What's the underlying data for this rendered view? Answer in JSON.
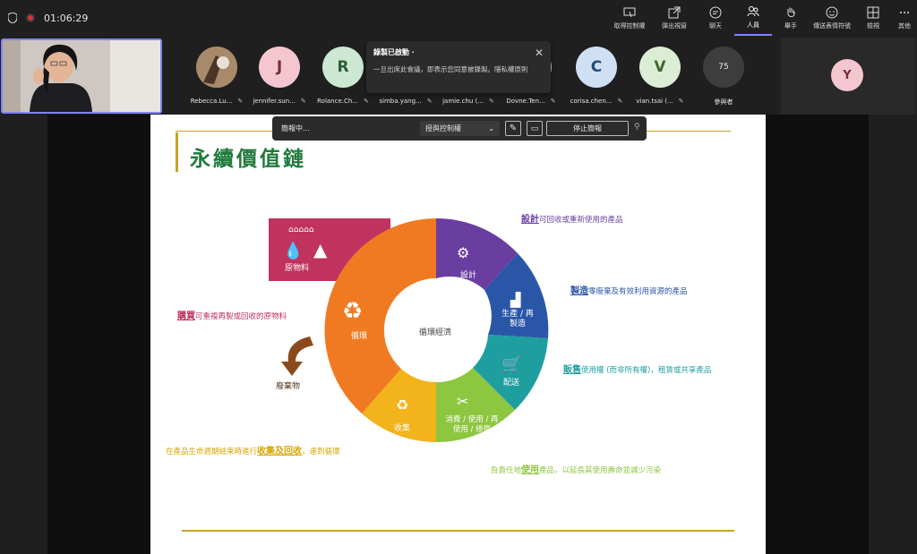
{
  "meeting": {
    "elapsed": "01:06:29"
  },
  "toolbar": {
    "items": [
      {
        "label": "取得控制權",
        "icon": "take-control-icon"
      },
      {
        "label": "彈出視窗",
        "icon": "pop-out-icon"
      },
      {
        "label": "聊天",
        "icon": "chat-icon"
      },
      {
        "label": "人員",
        "icon": "people-icon"
      },
      {
        "label": "舉手",
        "icon": "raise-hand-icon"
      },
      {
        "label": "傳送表情符號",
        "icon": "emoji-icon"
      },
      {
        "label": "檢視",
        "icon": "view-icon"
      },
      {
        "label": "其他",
        "icon": "more-icon"
      }
    ]
  },
  "participants": [
    {
      "name": "Rebecca.Lu...",
      "initial": "",
      "color": "#8a6b4d"
    },
    {
      "name": "jennifer.sun...",
      "initial": "J",
      "color": "#f4c7d0"
    },
    {
      "name": "Rolance.Ch...",
      "initial": "R",
      "color": "#cde8d2"
    },
    {
      "name": "simba.yang...",
      "initial": "",
      "color": "#d8d8d8"
    },
    {
      "name": "jamie.chu (...",
      "initial": "",
      "color": "#d8d8d8"
    },
    {
      "name": "Dovne.Ten...",
      "initial": "",
      "color": "#f4c7d0"
    },
    {
      "name": "corisa.chen...",
      "initial": "C",
      "color": "#cfe0f5"
    },
    {
      "name": "vian.tsai (...",
      "initial": "V",
      "color": "#dcedd5"
    }
  ],
  "participants_more": {
    "count": "75",
    "label": "參與者"
  },
  "right_tile": {
    "initial": "Y",
    "color": "#f4c7d0"
  },
  "toast": {
    "title": "錄製已啟動 ·",
    "body": "一旦出席此會議，即表示您同意被錄製。隱私權原則"
  },
  "share_bar": {
    "status": "簡報中...",
    "give_control": "授與控制權",
    "stop": "停止簡報"
  },
  "slide": {
    "title": "永續價值鏈",
    "center": "循環經濟",
    "segments": [
      {
        "label": "原物料",
        "color": "#c0335f"
      },
      {
        "label": "設計",
        "color": "#6a3ea1"
      },
      {
        "label": "生產 / 再製造",
        "color": "#2a56a8"
      },
      {
        "label": "配送",
        "color": "#1f9ea0"
      },
      {
        "label": "消費 / 使用 / 再使用 / 修復",
        "color": "#8dc63f"
      },
      {
        "label": "收集",
        "color": "#f2b31b"
      },
      {
        "label": "循環",
        "color": "#f07a22"
      },
      {
        "label": "廢棄物",
        "color": "#8b4a1c"
      }
    ],
    "captions": [
      {
        "key": "設計",
        "text": "可回收或重新使用的產品",
        "color": "#6a3ea1"
      },
      {
        "key": "製造",
        "text": "零廢棄及有效利用資源的產品",
        "color": "#2a56a8"
      },
      {
        "key": "販售",
        "text": "使用權 (而非所有權)，租賃或共享產品",
        "color": "#1f9ea0"
      },
      {
        "key": "購買",
        "text": "可重複再製或回收的原物料",
        "color": "#c0335f"
      },
      {
        "pre": "在產品生命週期結束時進行",
        "key": "收集及回收",
        "text": "，達到循環",
        "color": "#d9a400"
      },
      {
        "pre": "負責任地",
        "key": "使用",
        "text": "產品，以延長其使用壽命並減少污染",
        "color": "#8dc63f"
      }
    ]
  }
}
